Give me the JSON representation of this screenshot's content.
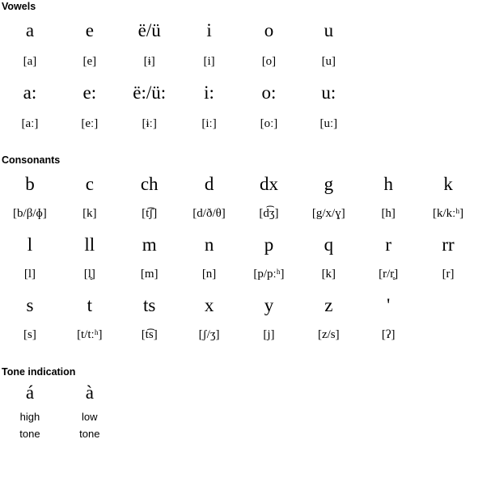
{
  "sections": {
    "vowels": {
      "heading": "Vowels",
      "rows": [
        {
          "letters": [
            "a",
            "e",
            "ë/ü",
            "i",
            "o",
            "u",
            "",
            ""
          ],
          "ipa": [
            "[a]",
            "[e]",
            "[ɨ]",
            "[i]",
            "[o]",
            "[u]",
            "",
            ""
          ]
        },
        {
          "letters": [
            "a:",
            "e:",
            "ë:/ü:",
            "i:",
            "o:",
            "u:",
            "",
            ""
          ],
          "ipa": [
            "[aː]",
            "[eː]",
            "[ɨː]",
            "[iː]",
            "[oː]",
            "[uː]",
            "",
            ""
          ]
        }
      ]
    },
    "consonants": {
      "heading": "Consonants",
      "rows": [
        {
          "letters": [
            "b",
            "c",
            "ch",
            "d",
            "dx",
            "g",
            "h",
            "k"
          ],
          "ipa": [
            "[b/β/ɸ]",
            "[k]",
            "[t͡ʃ]",
            "[d/ð/θ]",
            "[d͡ʒ]",
            "[g/x/ɣ]",
            "[h]",
            "[k/kːʰ]"
          ]
        },
        {
          "letters": [
            "l",
            "ll",
            "m",
            "n",
            "p",
            "q",
            "r",
            "rr"
          ],
          "ipa": [
            "[l]",
            "[l̥]",
            "[m]",
            "[n]",
            "[p/pːʰ]",
            "[k]",
            "[r/r̥]",
            "[r]"
          ]
        },
        {
          "letters": [
            "s",
            "t",
            "ts",
            "x",
            "y",
            "z",
            "'",
            ""
          ],
          "ipa": [
            "[s]",
            "[t/tːʰ]",
            "[t͡s]",
            "[ʃ/ʒ]",
            "[j]",
            "[z/s]",
            "[ʔ]",
            ""
          ]
        }
      ]
    },
    "tone": {
      "heading": "Tone indication",
      "items": [
        {
          "symbol": "á",
          "label_line1": "high",
          "label_line2": "tone"
        },
        {
          "symbol": "à",
          "label_line1": "low",
          "label_line2": "tone"
        }
      ]
    }
  },
  "colors": {
    "text": "#000000",
    "background": "#ffffff"
  }
}
